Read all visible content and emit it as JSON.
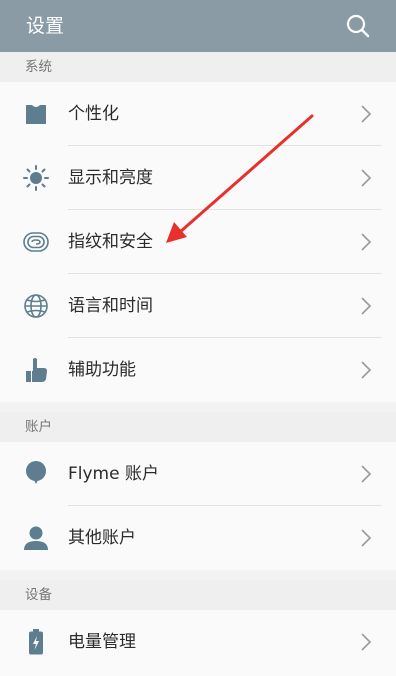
{
  "app": {
    "title": "设置"
  },
  "icons": {
    "search": "search-icon",
    "chevron": "chevron-right-icon"
  },
  "colors": {
    "appbar": "#8a9ba5",
    "icon": "#5e7d8f",
    "annotation": "#e8302d"
  },
  "sections": {
    "system": {
      "header": "系统",
      "items": [
        {
          "label": "个性化",
          "icon": "personalize-icon"
        },
        {
          "label": "显示和亮度",
          "icon": "brightness-icon"
        },
        {
          "label": "指纹和安全",
          "icon": "fingerprint-icon"
        },
        {
          "label": "语言和时间",
          "icon": "globe-icon"
        },
        {
          "label": "辅助功能",
          "icon": "hand-pointer-icon"
        }
      ]
    },
    "account": {
      "header": "账户",
      "items": [
        {
          "label": "Flyme 账户",
          "icon": "balloon-icon"
        },
        {
          "label": "其他账户",
          "icon": "person-icon"
        }
      ]
    },
    "device": {
      "header": "设备",
      "items": [
        {
          "label": "电量管理",
          "icon": "battery-icon"
        }
      ]
    }
  }
}
